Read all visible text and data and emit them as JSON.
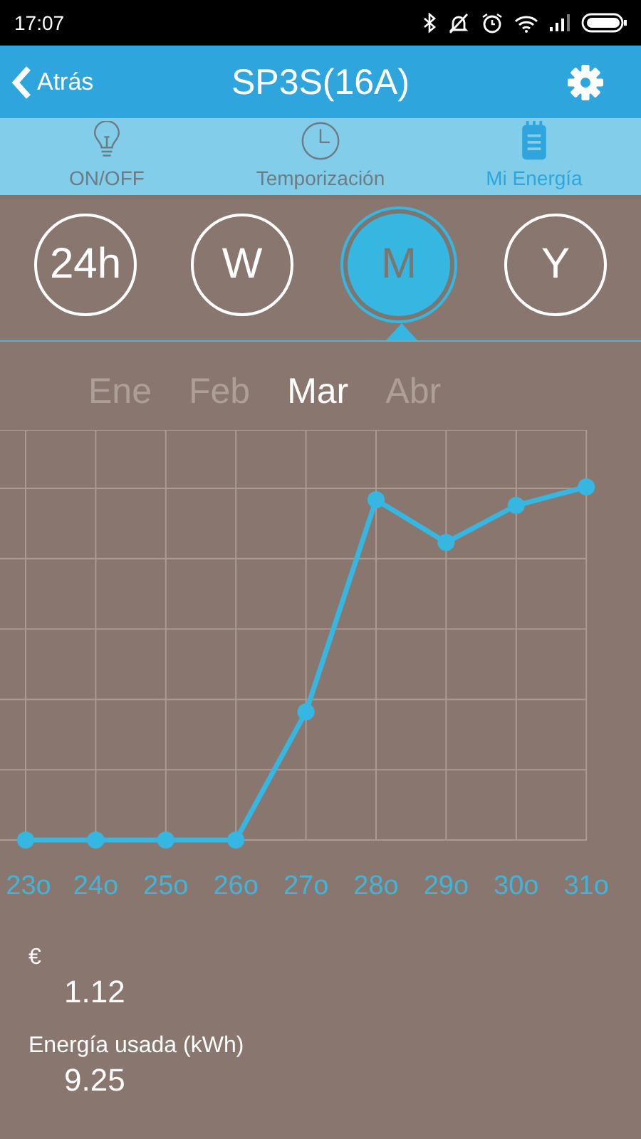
{
  "status_bar": {
    "time": "17:07"
  },
  "header": {
    "back": "Atrás",
    "title": "SP3S(16A)"
  },
  "tabs": [
    {
      "label": "ON/OFF",
      "kind": "bulb",
      "selected": false
    },
    {
      "label": "Temporización",
      "kind": "clock",
      "selected": false
    },
    {
      "label": "Mi Energía",
      "kind": "notepad",
      "selected": true
    }
  ],
  "periods": [
    {
      "label": "24h",
      "selected": false
    },
    {
      "label": "W",
      "selected": false
    },
    {
      "label": "M",
      "selected": true
    },
    {
      "label": "Y",
      "selected": false
    }
  ],
  "months": [
    {
      "label": "Ene",
      "selected": false
    },
    {
      "label": "Feb",
      "selected": false
    },
    {
      "label": "Mar",
      "selected": true
    },
    {
      "label": "Abr",
      "selected": false
    }
  ],
  "chart": {
    "x_labels": [
      "23o",
      "24o",
      "25o",
      "26o",
      "27o",
      "28o",
      "29o",
      "30o",
      "31o"
    ]
  },
  "summary": {
    "cost_label": "€",
    "cost": "1.12",
    "energy_label": "Energía usada (kWh)",
    "energy": "9.25"
  }
}
